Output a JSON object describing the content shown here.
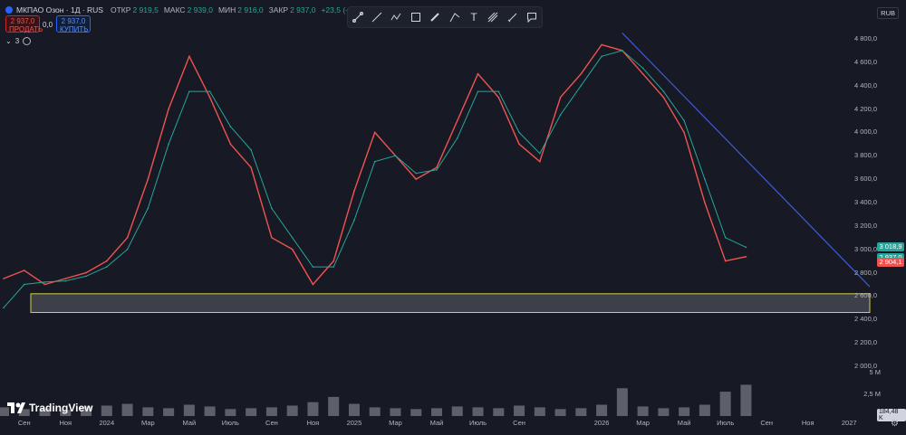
{
  "header": {
    "title": "МКПАО Озон · 1Д · RUS",
    "ohlc": [
      {
        "key": "ОТКР",
        "value": "2 919,5"
      },
      {
        "key": "МАКС",
        "value": "2 939,0"
      },
      {
        "key": "МИН",
        "value": "2 916,0"
      },
      {
        "key": "ЗАКР",
        "value": "2 937,0"
      },
      {
        "key": "",
        "value": "+23,5 (+0,81%)"
      }
    ],
    "sell_price": "2 937,0",
    "sell_label": "ПРОДАТЬ",
    "spread": "0,0",
    "buy_price": "2 937,0",
    "buy_label": "КУПИТЬ",
    "indicators_count": "3"
  },
  "currency": "RUB",
  "toolbar": {
    "tools": [
      "line-tool-icon",
      "trend-line-icon",
      "path-icon",
      "rectangle-icon",
      "brush-icon",
      "fib-icon",
      "text-icon",
      "pitchfork-icon",
      "measure-icon",
      "comment-icon"
    ]
  },
  "price_axis": [
    "4 800,0",
    "4 600,0",
    "4 400,0",
    "4 200,0",
    "4 000,0",
    "3 800,0",
    "3 600,0",
    "3 400,0",
    "3 200,0",
    "3 000,0",
    "2 800,0",
    "2 600,0",
    "2 400,0",
    "2 200,0",
    "2 000,0"
  ],
  "price_badges": [
    {
      "value": "3 018,9",
      "color": "#26a69a"
    },
    {
      "value": "2 937,0",
      "color": "#26a69a"
    },
    {
      "value": "2 904,1",
      "color": "#ef5350"
    }
  ],
  "volume_axis": [
    "5 M",
    "2,5 M"
  ],
  "volume_badge": "184,48 K",
  "time_axis": [
    "Сен",
    "Ноя",
    "2024",
    "Мар",
    "Май",
    "Июль",
    "Сен",
    "Ноя",
    "2025",
    "Мар",
    "Май",
    "Июль",
    "Сен",
    "2026",
    "Мар",
    "Май",
    "Июль",
    "Сен",
    "Ноя",
    "2027"
  ],
  "branding": "TradingView",
  "chart_data": {
    "type": "line",
    "series": [
      {
        "name": "",
        "color": "#ef5350",
        "x": [
          "2023-08",
          "2023-09",
          "2023-10",
          "2023-11",
          "2023-12",
          "2024-01",
          "2024-02",
          "2024-03",
          "2024-04",
          "2024-05",
          "2024-06",
          "2024-07",
          "2024-08",
          "2024-09",
          "2024-10",
          "2024-11",
          "2024-12",
          "2025-01",
          "2025-02",
          "2025-03",
          "2025-04",
          "2025-05",
          "2025-06",
          "2025-07",
          "2025-08",
          "2025-09",
          "2025-10",
          "2025-11",
          "2025-12",
          "2026-01",
          "2026-02",
          "2026-03",
          "2026-04",
          "2026-05",
          "2026-06",
          "2026-07",
          "2026-08"
        ],
        "values": [
          2750,
          2820,
          2700,
          2750,
          2800,
          2900,
          3100,
          3600,
          4200,
          4650,
          4300,
          3900,
          3700,
          3100,
          3000,
          2700,
          2900,
          3500,
          4000,
          3800,
          3600,
          3700,
          4100,
          4500,
          4300,
          3900,
          3750,
          4300,
          4500,
          4750,
          4700,
          4500,
          4300,
          4000,
          3400,
          2900,
          2937
        ]
      },
      {
        "name": "",
        "color": "#26a69a",
        "x": [
          "2023-08",
          "2023-09",
          "2023-10",
          "2023-11",
          "2023-12",
          "2024-01",
          "2024-02",
          "2024-03",
          "2024-04",
          "2024-05",
          "2024-06",
          "2024-07",
          "2024-08",
          "2024-09",
          "2024-10",
          "2024-11",
          "2024-12",
          "2025-01",
          "2025-02",
          "2025-03",
          "2025-04",
          "2025-05",
          "2025-06",
          "2025-07",
          "2025-08",
          "2025-09",
          "2025-10",
          "2025-11",
          "2025-12",
          "2026-01",
          "2026-02",
          "2026-03",
          "2026-04",
          "2026-05",
          "2026-06",
          "2026-07",
          "2026-08"
        ],
        "values": [
          2500,
          2700,
          2720,
          2730,
          2770,
          2850,
          3000,
          3350,
          3900,
          4350,
          4350,
          4050,
          3850,
          3350,
          3100,
          2850,
          2850,
          3250,
          3750,
          3800,
          3650,
          3680,
          3950,
          4350,
          4350,
          4000,
          3820,
          4150,
          4400,
          4650,
          4700,
          4550,
          4350,
          4100,
          3600,
          3100,
          3018
        ]
      }
    ],
    "trendline": {
      "from": [
        "2026-02",
        4850
      ],
      "to": [
        "2027-02",
        2680
      ],
      "color": "#3f5bd8"
    },
    "support_zone": {
      "from": "2023-08",
      "to": "2027-02",
      "low": 2460,
      "high": 2620
    },
    "ylim": [
      2000,
      4900
    ],
    "volume": [
      1.0,
      0.8,
      0.9,
      0.7,
      1.1,
      1.2,
      1.4,
      1.0,
      0.9,
      1.3,
      1.1,
      0.8,
      0.9,
      1.0,
      1.2,
      1.6,
      2.2,
      1.4,
      1.0,
      0.9,
      0.8,
      0.9,
      1.1,
      1.0,
      0.9,
      1.2,
      1.0,
      0.8,
      0.9,
      1.3,
      3.2,
      1.1,
      0.9,
      1.0,
      1.3,
      2.8,
      3.6
    ]
  }
}
